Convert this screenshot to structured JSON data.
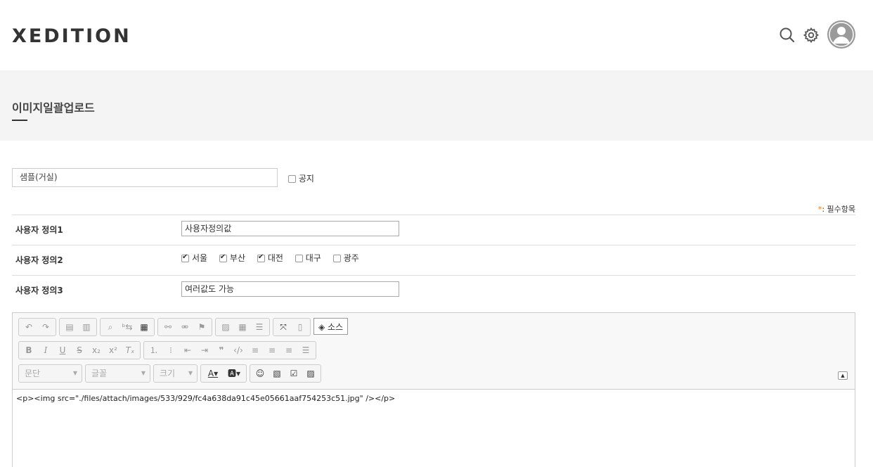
{
  "header": {
    "logo": "XEDITION",
    "icons": [
      "search-icon",
      "gear-icon",
      "user-avatar-icon"
    ]
  },
  "page": {
    "title": "이미지일괄업로드"
  },
  "form": {
    "title_value": "샘플(거실)",
    "notice_label": "공지",
    "notice_checked": false,
    "required_star": "*",
    "required_label": ": 필수항목",
    "fields": [
      {
        "label": "사용자 정의1",
        "value": "사용자정의값"
      },
      {
        "label": "사용자 정의2",
        "options": [
          {
            "label": "서울",
            "checked": true
          },
          {
            "label": "부산",
            "checked": true
          },
          {
            "label": "대전",
            "checked": true
          },
          {
            "label": "대구",
            "checked": false
          },
          {
            "label": "광주",
            "checked": false
          }
        ]
      },
      {
        "label": "사용자 정의3",
        "value": "여러값도 가능"
      }
    ]
  },
  "editor": {
    "source_label": "소스",
    "format_combo": "문단",
    "font_combo": "글꼴",
    "size_combo": "크기",
    "content": "<p><img src=\"./files/attach/images/533/929/fc4a638da91c45e05661aaf754253c51.jpg\" /></p>"
  },
  "colors": {
    "accent_required": "#e67e22",
    "band_bg": "#f4f4f4"
  }
}
